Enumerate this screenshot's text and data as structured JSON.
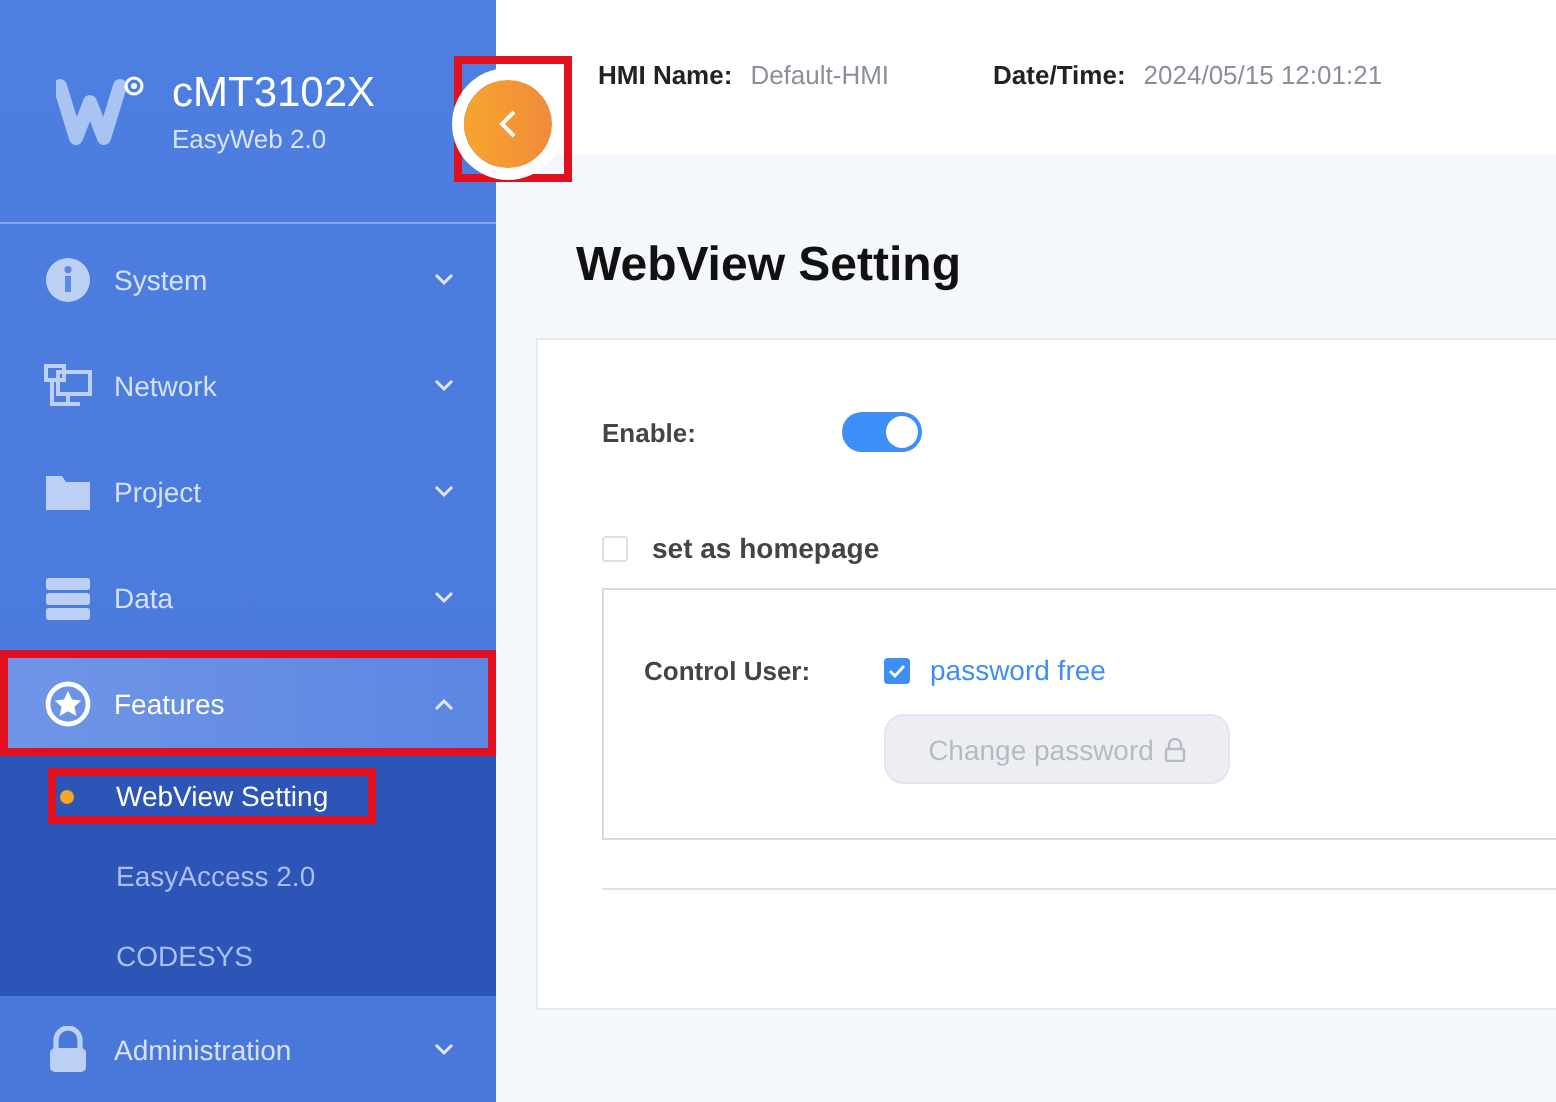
{
  "brand": {
    "name": "cMT3102X",
    "subtitle": "EasyWeb 2.0"
  },
  "collapse_button": {
    "highlighted": true
  },
  "header": {
    "fields": [
      {
        "label": "HMI Name:",
        "value": "Default-HMI"
      },
      {
        "label": "Date/Time:",
        "value": "2024/05/15 12:01:21"
      }
    ]
  },
  "sidebar": {
    "items": [
      {
        "kind": "info",
        "label": "System",
        "expanded": false,
        "selected": false,
        "highlighted": false
      },
      {
        "kind": "network",
        "label": "Network",
        "expanded": false,
        "selected": false,
        "highlighted": false
      },
      {
        "kind": "folder",
        "label": "Project",
        "expanded": false,
        "selected": false,
        "highlighted": false
      },
      {
        "kind": "data",
        "label": "Data",
        "expanded": false,
        "selected": false,
        "highlighted": false
      },
      {
        "kind": "star",
        "label": "Features",
        "expanded": true,
        "selected": true,
        "highlighted": true,
        "children": [
          {
            "label": "WebView Setting",
            "selected": true,
            "highlighted": true
          },
          {
            "label": "EasyAccess 2.0",
            "selected": false,
            "highlighted": false
          },
          {
            "label": "CODESYS",
            "selected": false,
            "highlighted": false
          }
        ]
      },
      {
        "kind": "lock",
        "label": "Administration",
        "expanded": false,
        "selected": false,
        "highlighted": false
      }
    ]
  },
  "page": {
    "title": "WebView Setting"
  },
  "form": {
    "enable": {
      "label": "Enable:",
      "on": true
    },
    "homepage": {
      "label": "set as homepage",
      "checked": false
    },
    "control_user": {
      "label": "Control User:",
      "option": {
        "label": "password free",
        "checked": true
      },
      "button": {
        "label": "Change password",
        "disabled": true
      }
    }
  }
}
